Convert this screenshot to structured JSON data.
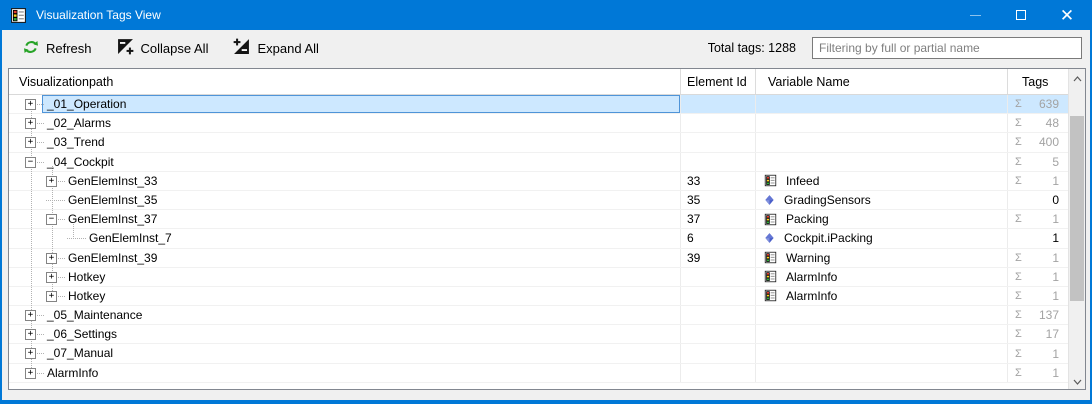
{
  "window": {
    "title": "Visualization Tags View"
  },
  "toolbar": {
    "refresh": "Refresh",
    "collapse_all": "Collapse All",
    "expand_all": "Expand All",
    "total_tags": "Total tags: 1288",
    "filter_placeholder": "Filtering by full or partial name",
    "filter_value": ""
  },
  "table": {
    "columns": {
      "path": "Visualizationpath",
      "element_id": "Element Id",
      "variable_name": "Variable Name",
      "tags": "Tags"
    },
    "sigma_symbol": "Σ",
    "rows": [
      {
        "level": 0,
        "expander": "plus",
        "path": "_01_Operation",
        "element_id": "",
        "var_icon": "",
        "var_name": "",
        "sigma": true,
        "tags": "639",
        "selected": true
      },
      {
        "level": 0,
        "expander": "plus",
        "path": "_02_Alarms",
        "element_id": "",
        "var_icon": "",
        "var_name": "",
        "sigma": true,
        "tags": "48",
        "selected": false
      },
      {
        "level": 0,
        "expander": "plus",
        "path": "_03_Trend",
        "element_id": "",
        "var_icon": "",
        "var_name": "",
        "sigma": true,
        "tags": "400",
        "selected": false
      },
      {
        "level": 0,
        "expander": "minus",
        "path": "_04_Cockpit",
        "element_id": "",
        "var_icon": "",
        "var_name": "",
        "sigma": true,
        "tags": "5",
        "selected": false
      },
      {
        "level": 1,
        "expander": "plus",
        "path": "GenElemInst_33",
        "element_id": "33",
        "var_icon": "screen",
        "var_name": "Infeed",
        "sigma": true,
        "tags": "1",
        "selected": false
      },
      {
        "level": 1,
        "expander": "none",
        "path": "GenElemInst_35",
        "element_id": "35",
        "var_icon": "variable",
        "var_name": "GradingSensors",
        "sigma": false,
        "tags": "0",
        "selected": false
      },
      {
        "level": 1,
        "expander": "minus",
        "path": "GenElemInst_37",
        "element_id": "37",
        "var_icon": "screen",
        "var_name": "Packing",
        "sigma": true,
        "tags": "1",
        "selected": false
      },
      {
        "level": 2,
        "expander": "none",
        "path": "GenElemInst_7",
        "element_id": "6",
        "var_icon": "variable",
        "var_name": "Cockpit.iPacking",
        "sigma": false,
        "tags": "1",
        "selected": false
      },
      {
        "level": 1,
        "expander": "plus",
        "path": "GenElemInst_39",
        "element_id": "39",
        "var_icon": "screen",
        "var_name": "Warning",
        "sigma": true,
        "tags": "1",
        "selected": false
      },
      {
        "level": 1,
        "expander": "plus",
        "path": "Hotkey",
        "element_id": "",
        "var_icon": "screen",
        "var_name": "AlarmInfo",
        "sigma": true,
        "tags": "1",
        "selected": false
      },
      {
        "level": 1,
        "expander": "plus",
        "path": "Hotkey",
        "element_id": "",
        "var_icon": "screen",
        "var_name": "AlarmInfo",
        "sigma": true,
        "tags": "1",
        "selected": false
      },
      {
        "level": 0,
        "expander": "plus",
        "path": "_05_Maintenance",
        "element_id": "",
        "var_icon": "",
        "var_name": "",
        "sigma": true,
        "tags": "137",
        "selected": false
      },
      {
        "level": 0,
        "expander": "plus",
        "path": "_06_Settings",
        "element_id": "",
        "var_icon": "",
        "var_name": "",
        "sigma": true,
        "tags": "17",
        "selected": false
      },
      {
        "level": 0,
        "expander": "plus",
        "path": "_07_Manual",
        "element_id": "",
        "var_icon": "",
        "var_name": "",
        "sigma": true,
        "tags": "1",
        "selected": false
      },
      {
        "level": 0,
        "expander": "plus",
        "path": "AlarmInfo",
        "element_id": "",
        "var_icon": "",
        "var_name": "",
        "sigma": true,
        "tags": "1",
        "selected": false
      }
    ]
  },
  "icons": {
    "app": "form-window-icon",
    "refresh": "refresh-icon",
    "collapse": "collapse-all-icon",
    "expand": "expand-all-icon",
    "screen": "screen-icon",
    "variable": "variable-tag-icon",
    "scroll_up": "chevron-up-icon",
    "scroll_down": "chevron-down-icon"
  },
  "colors": {
    "titlebar": "#0078d7",
    "selection_bg": "#cde8ff",
    "selection_border": "#4f94d8",
    "sum_text": "#a3a3a3",
    "refresh_green": "#27a327",
    "icon_red": "#e23b2e",
    "icon_yellow": "#ffd21e",
    "icon_green": "#2fae3a"
  }
}
